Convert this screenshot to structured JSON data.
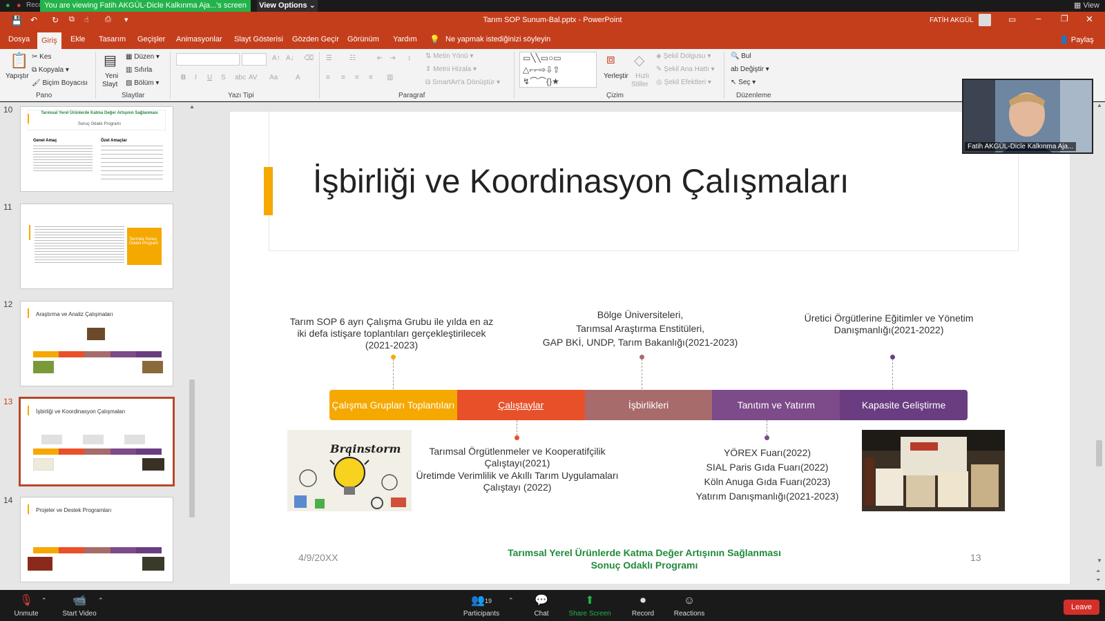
{
  "zoom": {
    "viewing_banner": "You are viewing Fatih AKGÜL-Dicle Kalkınma Aja...'s screen",
    "view_options": "View Options",
    "view_top": "View",
    "recording": "Recording",
    "toolbar": {
      "unmute": "Unmute",
      "start_video": "Start Video",
      "participants": "Participants",
      "participants_count": "19",
      "chat": "Chat",
      "share_screen": "Share Screen",
      "record": "Record",
      "reactions": "Reactions",
      "leave": "Leave"
    },
    "video_name": "Fatih AKGÜL-Dicle Kalkınma Aja..."
  },
  "window": {
    "title": "Tarım SOP Sunum-Bal.pptx  -  PowerPoint",
    "user": "FATİH AKGÜL"
  },
  "tabs": [
    "Dosya",
    "Giriş",
    "Ekle",
    "Tasarım",
    "Geçişler",
    "Animasyonlar",
    "Slayt Gösterisi",
    "Gözden Geçir",
    "Görünüm",
    "Yardım"
  ],
  "tell_me": "Ne yapmak istediğinizi söyleyin",
  "share": "Paylaş",
  "ribbon": {
    "groups": [
      "Pano",
      "Slaytlar",
      "Yazı Tipi",
      "Paragraf",
      "Çizim",
      "Düzenleme"
    ],
    "paste": "Yapıştır",
    "cut": "Kes",
    "copy": "Kopyala",
    "format_painter": "Biçim Boyacısı",
    "new_slide_line1": "Yeni",
    "new_slide_line2": "Slayt",
    "layout": "Düzen",
    "reset": "Sıfırla",
    "section": "Bölüm",
    "text_direction": "Metin Yönü",
    "align_text": "Metni Hizala",
    "smartart": "SmartArt'a Dönüştür",
    "arrange": "Yerleştir",
    "quick_styles_line1": "Hızlı",
    "quick_styles_line2": "Stiller",
    "shape_fill": "Şekil Dolgusu",
    "shape_outline": "Şekil Ana Hattı",
    "shape_effects": "Şekil Efektleri",
    "find": "Bul",
    "replace": "Değiştir",
    "select": "Seç"
  },
  "thumbnails": [
    {
      "num": "10",
      "title": "Tarımsal Yerel Ürünlerde Katma Değer Artışının Sağlanması",
      "sub": "Sonuç Odaklı Programı",
      "left_head": "Genel Amaç",
      "right_head": "Özel Amaçlar"
    },
    {
      "num": "11",
      "box": "Tarımda Sonuç Odaklı Program"
    },
    {
      "num": "12",
      "title": "Araştırma ve Analiz Çalışmaları"
    },
    {
      "num": "13",
      "title": "İşbirliği ve Koordinasyon Çalışmaları"
    },
    {
      "num": "14",
      "title": "Projeler ve Destek Programları"
    }
  ],
  "slide": {
    "title": "İşbirliği ve Koordinasyon Çalışmaları",
    "top_notes": [
      "Tarım SOP 6 ayrı Çalışma Grubu ile yılda en az iki defa istişare toplantıları gerçekleştirilecek (2021-2023)",
      "Bölge Üniversiteleri,\nTarımsal Araştırma Enstitüleri,\nGAP BKİ, UNDP, Tarım Bakanlığı(2021-2023)",
      "Üretici Örgütlerine Eğitimler ve Yönetim Danışmanlığı(2021-2022)"
    ],
    "segments": [
      {
        "label": "Çalışma Grupları Toplantıları",
        "color": "#f5a800"
      },
      {
        "label": "Çalıştaylar",
        "color": "#e8502a"
      },
      {
        "label": "İşbirlikleri",
        "color": "#a86b6b"
      },
      {
        "label": "Tanıtım ve Yatırım",
        "color": "#7d4a8a"
      },
      {
        "label": "Kapasite Geliştirme",
        "color": "#6a3d80"
      }
    ],
    "bottom_notes": [
      "Tarımsal Örgütlenmeler ve Kooperatifçilik Çalıştayı(2021)",
      "Üretimde Verimlilik ve Akıllı Tarım Uygulamaları Çalıştayı (2022)",
      "YÖREX Fuarı(2022)\nSIAL Paris Gıda Fuarı(2022)\nKöln Anuga Gıda Fuarı(2023)\nYatırım Danışmanlığı(2021-2023)"
    ],
    "brainstorm_label": "Brainstorm",
    "footer_date": "4/9/20XX",
    "footer_line1": "Tarımsal Yerel Ürünlerde Katma Değer Artışının Sağlanması",
    "footer_line2": "Sonuç Odaklı Programı",
    "page_number": "13"
  },
  "colors": {
    "ppt_red": "#c43e1c",
    "accent_yellow": "#f5a800",
    "footer_green": "#1f8a3a",
    "zoom_green": "#23b34a"
  }
}
